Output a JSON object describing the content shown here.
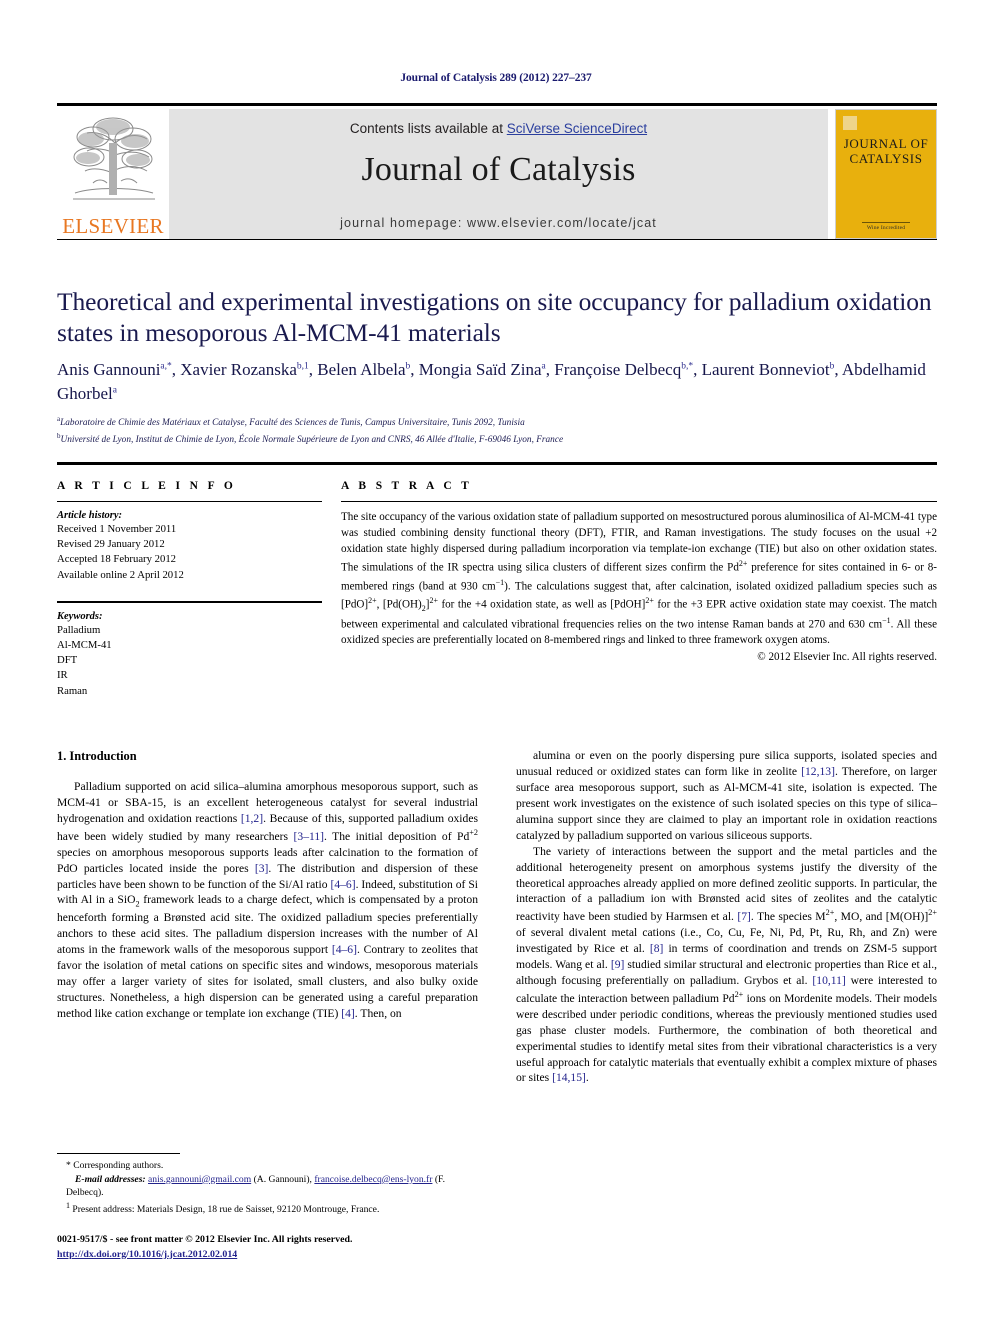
{
  "running_head": "Journal of Catalysis 289 (2012) 227–237",
  "masthead": {
    "elsevier_wordmark": "ELSEVIER",
    "contents_prefix": "Contents lists available at ",
    "contents_link": "SciVerse ScienceDirect",
    "journal_name": "Journal of Catalysis",
    "homepage": "journal homepage: www.elsevier.com/locate/jcat",
    "cover_title_line1": "JOURNAL OF",
    "cover_title_line2": "CATALYSIS",
    "cover_footer": "Wine Incredited",
    "cover_color": "#e8b00d",
    "link_color": "#2b3f9e",
    "elsevier_orange": "#e87722"
  },
  "article": {
    "title": "Theoretical and experimental investigations on site occupancy for palladium oxidation states in mesoporous Al-MCM-41 materials",
    "authors_html": "Anis Gannouni<sup>a,*</sup>, Xavier Rozanska<sup>b,1</sup>, Belen Albela<sup>b</sup>, Mongia Saïd Zina<sup>a</sup>, Françoise Delbecq<sup>b,*</sup>, Laurent Bonneviot<sup>b</sup>, Abdelhamid Ghorbel<sup>a</sup>",
    "affiliation_a": "Laboratoire de Chimie des Matériaux et Catalyse, Faculté des Sciences de Tunis, Campus Universitaire, Tunis 2092, Tunisia",
    "affiliation_b": "Université de Lyon, Institut de Chimie de Lyon, École Normale Supérieure de Lyon and CNRS, 46 Allée d'Italie, F-69046 Lyon, France"
  },
  "article_info": {
    "heading": "A R T I C L E   I N F O",
    "history_label": "Article history:",
    "history": [
      "Received 1 November 2011",
      "Revised 29 January 2012",
      "Accepted 18 February 2012",
      "Available online 2 April 2012"
    ],
    "keywords_label": "Keywords:",
    "keywords": [
      "Palladium",
      "Al-MCM-41",
      "DFT",
      "IR",
      "Raman"
    ]
  },
  "abstract": {
    "heading": "A B S T R A C T",
    "text_html": "The site occupancy of the various oxidation state of palladium supported on mesostructured porous aluminosilica of Al-MCM-41 type was studied combining density functional theory (DFT), FTIR, and Raman investigations. The study focuses on the usual +2 oxidation state highly dispersed during palladium incorporation via template-ion exchange (TIE) but also on other oxidation states. The simulations of the IR spectra using silica clusters of different sizes confirm the Pd<sup>2+</sup> preference for sites contained in 6- or 8-membered rings (band at 930 cm<sup>−1</sup>). The calculations suggest that, after calcination, isolated oxidized palladium species such as [PdO]<sup>2+</sup>, [Pd(OH)<sub>2</sub>]<sup>2+</sup> for the +4 oxidation state, as well as [PdOH]<sup>2+</sup> for the +3 EPR active oxidation state may coexist. The match between experimental and calculated vibrational frequencies relies on the two intense Raman bands at 270 and 630 cm<sup>−1</sup>. All these oxidized species are preferentially located on 8-membered rings and linked to three framework oxygen atoms.",
    "copyright": "© 2012 Elsevier Inc. All rights reserved."
  },
  "body": {
    "section_heading": "1. Introduction",
    "left_paragraphs_html": [
      "Palladium supported on acid silica–alumina amorphous mesoporous support, such as MCM-41 or SBA-15, is an excellent heterogeneous catalyst for several industrial hydrogenation and oxidation reactions <span class=\"ref\">[1,2]</span>. Because of this, supported palladium oxides have been widely studied by many researchers <span class=\"ref\">[3–11]</span>. The initial deposition of Pd<sup>+2</sup> species on amorphous mesoporous supports leads after calcination to the formation of PdO particles located inside the pores <span class=\"ref\">[3]</span>. The distribution and dispersion of these particles have been shown to be function of the Si/Al ratio <span class=\"ref\">[4–6]</span>. Indeed, substitution of Si with Al in a SiO<sub>2</sub> framework leads to a charge defect, which is compensated by a proton henceforth forming a Brønsted acid site. The oxidized palladium species preferentially anchors to these acid sites. The palladium dispersion increases with the number of Al atoms in the framework walls of the mesoporous support <span class=\"ref\">[4–6]</span>. Contrary to zeolites that favor the isolation of metal cations on specific sites and windows, mesoporous materials may offer a larger variety of sites for isolated, small clusters, and also bulky oxide structures. Nonetheless, a high dispersion can be generated using a careful preparation method like cation exchange or template ion exchange (TIE) <span class=\"ref\">[4]</span>. Then, on"
    ],
    "right_paragraphs_html": [
      "alumina or even on the poorly dispersing pure silica supports, isolated species and unusual reduced or oxidized states can form like in zeolite <span class=\"ref\">[12,13]</span>. Therefore, on larger surface area mesoporous support, such as Al-MCM-41 site, isolation is expected. The present work investigates on the existence of such isolated species on this type of silica–alumina support since they are claimed to play an important role in oxidation reactions catalyzed by palladium supported on various siliceous supports.",
      "The variety of interactions between the support and the metal particles and the additional heterogeneity present on amorphous systems justify the diversity of the theoretical approaches already applied on more defined zeolitic supports. In particular, the interaction of a palladium ion with Brønsted acid sites of zeolites and the catalytic reactivity have been studied by Harmsen et al. <span class=\"ref\">[7]</span>. The species M<sup>2+</sup>, MO, and [M(OH)]<sup>2+</sup> of several divalent metal cations (i.e., Co, Cu, Fe, Ni, Pd, Pt, Ru, Rh, and Zn) were investigated by Rice et al. <span class=\"ref\">[8]</span> in terms of coordination and trends on ZSM-5 support models. Wang et al. <span class=\"ref\">[9]</span> studied similar structural and electronic properties than Rice et al., although focusing preferentially on palladium. Grybos et al. <span class=\"ref\">[10,11]</span> were interested to calculate the interaction between palladium Pd<sup>2+</sup> ions on Mordenite models. Their models were described under periodic conditions, whereas the previously mentioned studies used gas phase cluster models. Furthermore, the combination of both theoretical and experimental studies to identify metal sites from their vibrational characteristics is a very useful approach for catalytic materials that eventually exhibit a complex mixture of phases or sites <span class=\"ref\">[14,15]</span>."
    ]
  },
  "footnotes": {
    "corresponding": "* Corresponding authors.",
    "email_label": "E-mail addresses:",
    "email_1": "anis.gannouni@gmail.com",
    "email_1_name": "(A. Gannouni),",
    "email_2": "francoise.delbecq@ens-lyon.fr",
    "email_2_name": "(F. Delbecq).",
    "present_address_marker": "1",
    "present_address": "Present address: Materials Design, 18 rue de Saisset, 92120 Montrouge, France."
  },
  "imprint": {
    "issn_line": "0021-9517/$ - see front matter © 2012 Elsevier Inc. All rights reserved.",
    "doi": "http://dx.doi.org/10.1016/j.jcat.2012.02.014"
  }
}
